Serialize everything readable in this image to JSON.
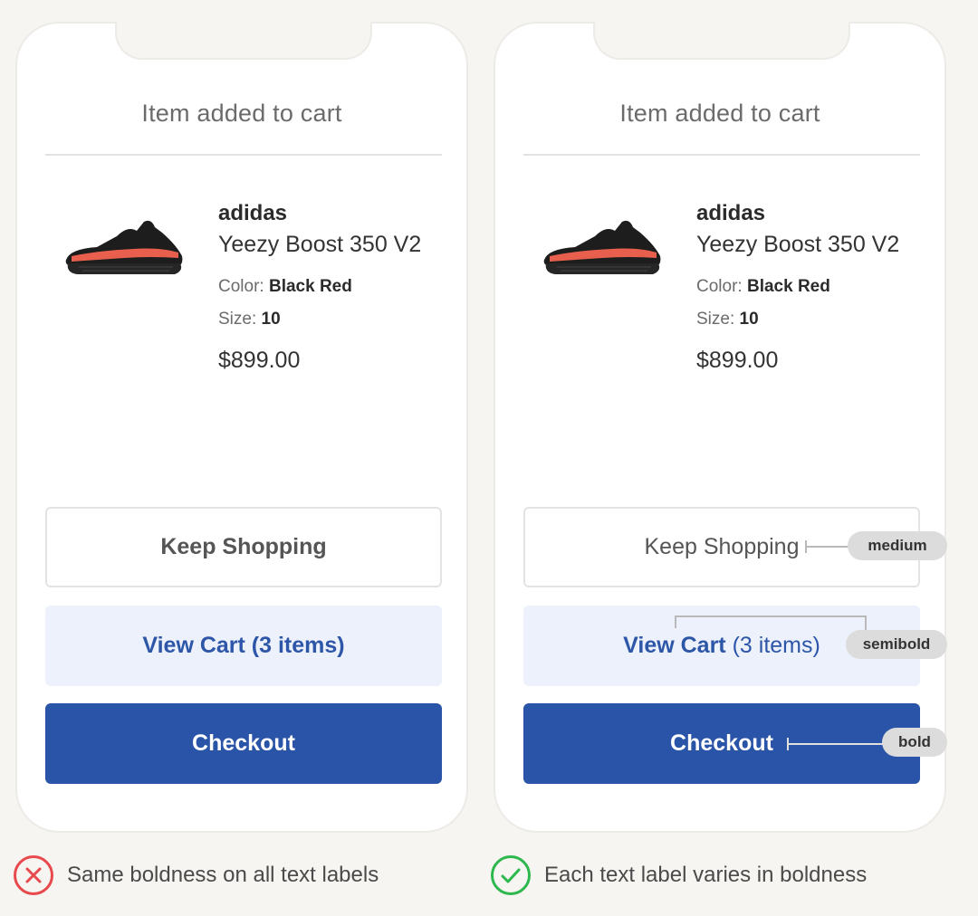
{
  "colors": {
    "background": "#f7f5f1",
    "primary_blue": "#2a54a8",
    "light_blue": "#ecf1fb",
    "bad_red": "#e8494c",
    "good_green": "#2db84d"
  },
  "icons": {
    "product_image": "sneaker",
    "bad": "x-circle-icon",
    "good": "check-circle-icon"
  },
  "cards": [
    {
      "title": "Item added to cart",
      "product": {
        "brand": "adidas",
        "name": "Yeezy Boost 350 V2",
        "color_label": "Color:",
        "color_value": "Black Red",
        "size_label": "Size:",
        "size_value": "10",
        "price": "$899.00"
      },
      "buttons": {
        "keep_shopping": "Keep Shopping",
        "view_cart": "View Cart (3 items)",
        "checkout": "Checkout"
      }
    },
    {
      "title": "Item added to cart",
      "product": {
        "brand": "adidas",
        "name": "Yeezy Boost 350 V2",
        "color_label": "Color:",
        "color_value": "Black Red",
        "size_label": "Size:",
        "size_value": "10",
        "price": "$899.00"
      },
      "buttons": {
        "keep_shopping": "Keep Shopping",
        "view_cart_strong": "View Cart",
        "view_cart_weak": "(3 items)",
        "checkout": "Checkout"
      },
      "annotations": {
        "keep_shopping": "medium",
        "view_cart": "semibold",
        "checkout": "bold"
      }
    }
  ],
  "captions": {
    "bad": "Same boldness on all text labels",
    "good": "Each text label varies in boldness"
  }
}
